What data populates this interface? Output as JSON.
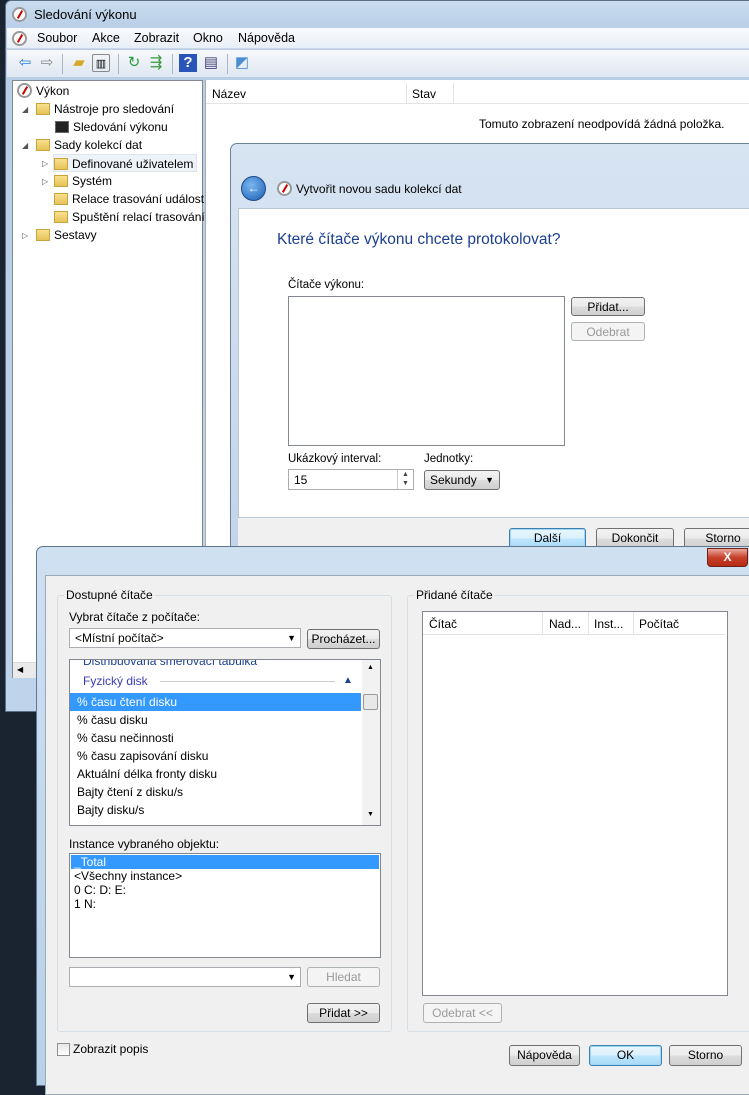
{
  "main_window": {
    "title": "Sledování výkonu",
    "menu": [
      "Soubor",
      "Akce",
      "Zobrazit",
      "Okno",
      "Nápověda"
    ],
    "toolbar_icons": [
      "back-icon",
      "forward-icon",
      "up-folder-icon",
      "show-hide-tree-icon",
      "refresh-icon",
      "export-list-icon",
      "help-icon",
      "action-pane-icon",
      "new-window-icon"
    ],
    "tree": {
      "root": "Výkon",
      "items": [
        {
          "label": "Nástroje pro sledování"
        },
        {
          "label": "Sledování výkonu"
        },
        {
          "label": "Sady kolekcí dat"
        },
        {
          "label": "Definované uživatelem"
        },
        {
          "label": "Systém"
        },
        {
          "label": "Relace trasování událostí"
        },
        {
          "label": "Spuštění relací trasování událostí"
        },
        {
          "label": "Sestavy"
        }
      ]
    },
    "list": {
      "columns": [
        "Název",
        "Stav"
      ],
      "empty_message": "Tomuto zobrazení neodpovídá žádná položka."
    }
  },
  "wizard": {
    "title": "Vytvořit novou sadu kolekcí dat",
    "heading": "Které čítače výkonu chcete protokolovat?",
    "counters_label": "Čítače výkonu:",
    "add_button": "Přidat...",
    "remove_button": "Odebrat",
    "interval_label": "Ukázkový interval:",
    "interval_value": "15",
    "units_label": "Jednotky:",
    "units_value": "Sekundy",
    "buttons": {
      "next": "Další",
      "finish": "Dokončit",
      "cancel": "Storno"
    }
  },
  "add_counters": {
    "available_group": "Dostupné čítače",
    "computer_label": "Vybrat čítače z počítače:",
    "computer_value": "<Místní počítač>",
    "browse_button": "Procházet...",
    "counter_list": {
      "partial_item": "Distribuovaná směrovací tabulka",
      "category": "Fyzický disk",
      "items": [
        "% času čtení disku",
        "% času disku",
        "% času nečinnosti",
        "% času zapisování disku",
        "Aktuální délka fronty disku",
        "Bajty čtení z disku/s",
        "Bajty disku/s"
      ]
    },
    "instances_label": "Instance vybraného objektu:",
    "instances": [
      "_Total",
      "<Všechny instance>",
      "0 C: D: E:",
      "1 N:"
    ],
    "search_button": "Hledat",
    "add_button": "Přidat >>",
    "added_group": "Přidané čítače",
    "added_columns": [
      "Čítač",
      "Nad...",
      "Inst...",
      "Počítač"
    ],
    "remove_button": "Odebrat <<",
    "show_description": "Zobrazit popis",
    "show_description_checked": false,
    "buttons": {
      "help": "Nápověda",
      "ok": "OK",
      "cancel": "Storno"
    },
    "close": "X"
  }
}
